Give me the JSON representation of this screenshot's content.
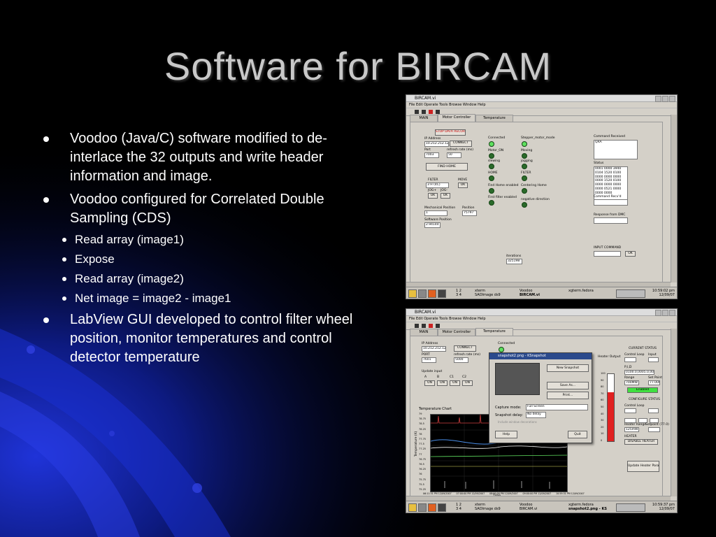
{
  "slide": {
    "title": "Software for BIRCAM",
    "bullets": [
      {
        "text": "Voodoo (Java/C) software modified to de-interlace the 32 outputs and write header information and image."
      },
      {
        "text": "Voodoo configured for Correlated Double Sampling (CDS)",
        "sub": [
          "Read array (image1)",
          "Expose",
          "Read array (image2)",
          "Net image = image2 - image1"
        ]
      },
      {
        "text": "LabView GUI developed to control filter wheel position, monitor temperatures and control detector temperature"
      }
    ]
  },
  "colors": {
    "background": "#000000",
    "accent_blue": "#1a2fd0",
    "title": "#c8c8c8"
  },
  "screenshot1": {
    "window_title": "BIRCAM.vi",
    "menu": "File  Edit  Operate  Tools  Browse  Window  Help",
    "tabs": [
      "MAIN",
      "Motor Controller",
      "Temperature Controller"
    ],
    "stop_button": "STOP DATA RECORD",
    "ip_label": "IP Address",
    "ip_value": "10.212.212.122",
    "connect": "CONNECT",
    "port_label": "Port",
    "port_value": "7003",
    "refresh_label": "refresh rate (ms)",
    "refresh_value": "50",
    "find_home": "FIND HOME",
    "filter_label": "FILTER",
    "filter_value": "3  H (4C)",
    "move_label": "MOVE",
    "ok": "OK",
    "jog_plus": "JOG+",
    "jog_minus": "JOG-",
    "mech_pos_label": "Mechanical Position",
    "mech_pos_value": "1",
    "position_label": "Position",
    "position_value": "75797",
    "sw_pos_label": "Software Position",
    "sw_pos_value": "2.94144",
    "leds": [
      "Connected",
      "Motor_ON",
      "slewing",
      "HOME",
      "Find Home enabled",
      "First filter enabled"
    ],
    "leds_right": [
      "Stepper_motor_mode",
      "Moving",
      "jogging",
      "FILTER",
      "Centering Home",
      "negative direction"
    ],
    "command_received_label": "Command Received",
    "command_received_value": "QRA",
    "status_label": "Status",
    "status_lines": [
      "0001 0000 3940",
      "0104 1520 0100",
      "0000 0000 0000",
      "0000 1520 0100",
      "0000 0000 0000",
      "0000 0521 0000",
      "0000 0000"
    ],
    "command_recv2": "Command Recv'd",
    "response_label": "Response from DMC",
    "input_command": "INPUT COMMAND",
    "iterations_label": "iterations",
    "iterations_value": "325198",
    "taskbar_items": [
      "xterm",
      "Voodoo",
      "xgterm.fedora",
      "SAOImage ds9",
      "BIRCAM.vi"
    ],
    "workspaces": [
      "1",
      "2",
      "3",
      "4"
    ],
    "time": "10:59:02 pm",
    "date": "12/09/07"
  },
  "screenshot2": {
    "window_title": "BIRCAM.vi",
    "menu": "File  Edit  Operate  Tools  Browse  Window  Help",
    "tabs": [
      "MAIN",
      "Motor Controller",
      "Temperature Controller"
    ],
    "ip_label": "IP Address",
    "ip_value": "10.212.212.122",
    "connect": "CONNECT",
    "port_label": "PORT",
    "port_value": "7601",
    "refresh_label": "refresh rate (ms)",
    "refresh_value": "5000",
    "connected": "Connected",
    "update_input": "Update input",
    "ch_labels": [
      "A",
      "B",
      "C1",
      "C2"
    ],
    "on": "ON",
    "chart_title": "Temperature Chart",
    "chart_yticks": [
      "79",
      "78.75",
      "78.5",
      "78.25",
      "78",
      "77.75",
      "77.5",
      "77.25",
      "77",
      "76.75",
      "76.5",
      "76.25",
      "76",
      "75.75",
      "75.5",
      "75.25"
    ],
    "chart_xticks": [
      "06:11:31 PM 12/09/2007",
      "07:00:00 PM 12/09/2007",
      "08:00:00 PM 12/09/2007",
      "09:00:00 PM 12/09/2007",
      "10:59:31 PM 12/09/2007"
    ],
    "chart_ylabel": "Temperature (K)",
    "chart_xlabel": "Time",
    "heater_output": "Heater Output",
    "heater_ticks": [
      "100",
      "90",
      "80",
      "70",
      "60",
      "50",
      "40",
      "30",
      "20",
      "10",
      "0"
    ],
    "current_status": "CURRENT STATUS",
    "control_loop": "Control Loop",
    "input_label": "Input",
    "p_i_d": "P,I,D",
    "pid_value": "0100.0,0005.0,0050",
    "range_label": "Range",
    "setpoint_label": "Set Point",
    "range_value": "700MW",
    "setpoint_value": "77.000",
    "enabled": "Enabled",
    "configure_status": "CONFIGURE STATUS",
    "heater_range": "Heater Range",
    "setpoint_k": "Setpoint (77.0)",
    "heater_range_value": "125mW",
    "heater_label": "HEATER",
    "disable_heater": "DISABLE HEATER",
    "update_heater": "Update Heater Parameters",
    "dialog_title": "snapshot2.png - KSnapshot",
    "new_snapshot": "New Snapshot",
    "save_as": "Save As...",
    "print": "Print...",
    "capture_mode_label": "Capture mode:",
    "capture_mode_value": "Full Screen",
    "delay_label": "Snapshot delay:",
    "delay_value": "No delay",
    "include_decorations": "Include window decorations",
    "help": "Help",
    "quit": "Quit",
    "taskbar_items": [
      "xterm",
      "Voodoo",
      "xgterm.fedora",
      "SAOImage ds9",
      "BIRCAM.vi",
      "snapshot2.png - KS"
    ],
    "workspaces": [
      "1",
      "2",
      "3",
      "4"
    ],
    "time": "10:59:37 pm",
    "date": "12/09/07"
  }
}
